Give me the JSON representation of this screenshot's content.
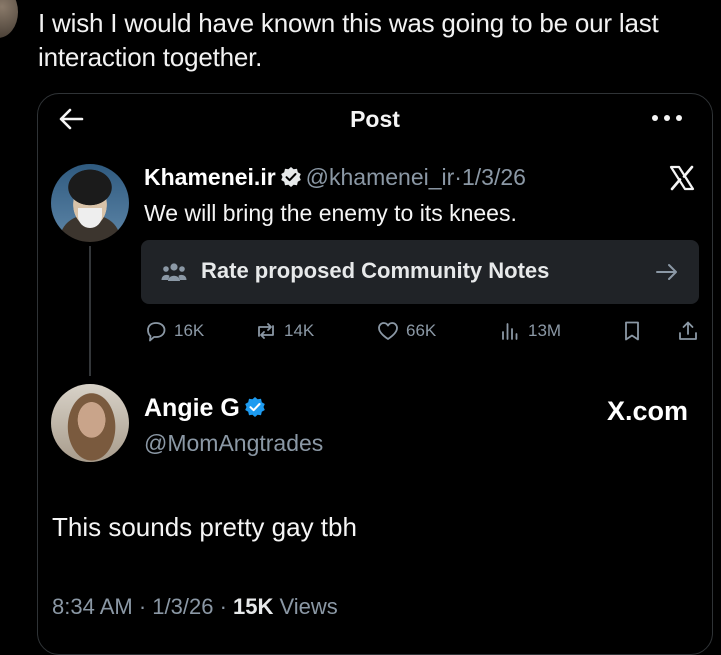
{
  "outer_tweet": {
    "text": "I wish I would have known this was going to be our last interaction together."
  },
  "card": {
    "header": {
      "title": "Post"
    },
    "original_post": {
      "author_name": "Khamenei.ir",
      "handle": "@khamenei_ir",
      "separator": "·",
      "date": "1/3/26",
      "text": "We will bring the enemy to its knees.",
      "community_notes_label": "Rate proposed Community Notes",
      "metrics": {
        "replies": "16K",
        "reposts": "14K",
        "likes": "66K",
        "views": "13M"
      }
    },
    "reply_post": {
      "author_name": "Angie G",
      "handle": "@MomAngtrades",
      "brand": "X.com",
      "text": "This sounds pretty gay tbh",
      "footer": {
        "time": "8:34 AM",
        "sep1": " · ",
        "date": "1/3/26",
        "sep2": " · ",
        "views_count": "15K",
        "views_label": " Views"
      }
    }
  },
  "colors": {
    "background": "#000000",
    "muted_text": "#8b98a5",
    "verified": "#1d9bf0",
    "notes_bg": "#202327"
  }
}
